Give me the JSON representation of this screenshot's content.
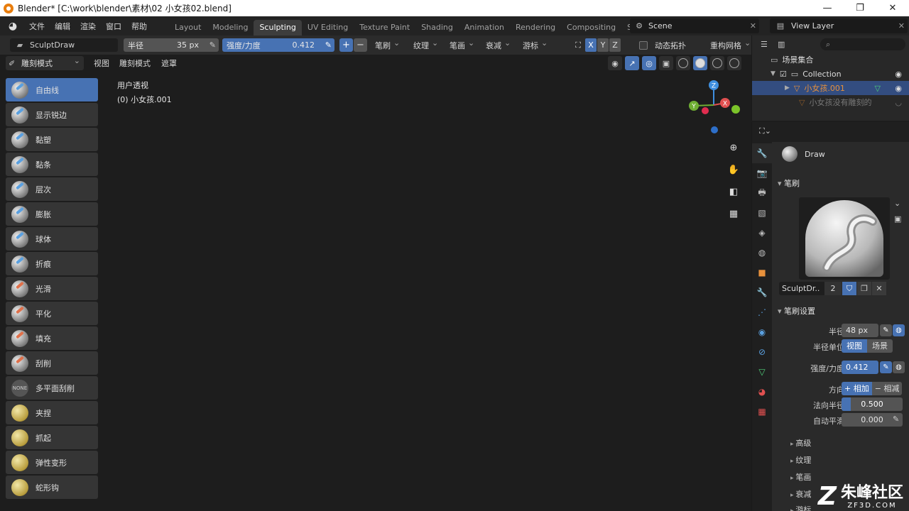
{
  "window": {
    "title": "Blender* [C:\\work\\blender\\素材\\02 小女孩02.blend]",
    "controls": [
      "—",
      "❐",
      "✕"
    ]
  },
  "menubar": {
    "items": [
      "文件",
      "编辑",
      "渲染",
      "窗口",
      "帮助"
    ],
    "workspaces": [
      "Layout",
      "Modeling",
      "Sculpting",
      "UV Editing",
      "Texture Paint",
      "Shading",
      "Animation",
      "Rendering",
      "Compositing",
      "Sc"
    ],
    "active_workspace": "Sculpting",
    "scene": "Scene",
    "view_layer": "View Layer"
  },
  "tool_header": {
    "brush_name": "SculptDraw",
    "radius_label": "半径",
    "radius_value": "35 px",
    "strength_label": "强度/力度",
    "strength_value": "0.412",
    "plus": "+",
    "minus": "−",
    "dropdowns": [
      "笔刷",
      "纹理",
      "笔画",
      "衰减",
      "游标"
    ],
    "axes": [
      "X",
      "Y",
      "Z"
    ],
    "dyntopo": "动态拓扑",
    "remesh": "重构网格"
  },
  "viewport_header": {
    "mode": "雕刻模式",
    "menus": [
      "视图",
      "雕刻模式",
      "遮罩"
    ]
  },
  "viewport": {
    "view_name": "用户透视",
    "object_label": "(0) 小女孩.001",
    "gizmo": {
      "x": "X",
      "y": "Y",
      "z": "Z"
    }
  },
  "tools": [
    {
      "label": "自由线",
      "active": true
    },
    {
      "label": "显示锐边"
    },
    {
      "label": "黏塑"
    },
    {
      "label": "黏条"
    },
    {
      "label": "层次"
    },
    {
      "label": "膨胀"
    },
    {
      "label": "球体"
    },
    {
      "label": "折痕"
    },
    {
      "label": "光滑"
    },
    {
      "label": "平化"
    },
    {
      "label": "填充"
    },
    {
      "label": "刮削"
    },
    {
      "label": "多平面刮削"
    },
    {
      "label": "夹捏"
    },
    {
      "label": "抓起"
    },
    {
      "label": "弹性变形"
    },
    {
      "label": "蛇形钩"
    }
  ],
  "outliner": {
    "scene_collection": "场景集合",
    "collection": "Collection",
    "object_selected": "小女孩.001",
    "object_other": "小女孩没有雕刻的"
  },
  "properties": {
    "brush_title": "Draw",
    "panel_brush": "笔刷",
    "brush_slot_name": "SculptDr..",
    "brush_slot_users": "2",
    "panel_brush_settings": "笔刷设置",
    "radius_label": "半径",
    "radius_value": "48 px",
    "radius_unit_label": "半径单位",
    "radius_unit_options": [
      "视图",
      "场景"
    ],
    "strength_label": "强度/力度",
    "strength_value": "0.412",
    "direction_label": "方向",
    "direction_options": [
      "+ 相加",
      "− 相减"
    ],
    "normal_radius_label": "法向半径",
    "normal_radius_value": 0.5,
    "normal_radius_text": "0.500",
    "autosmooth_label": "自动平滑",
    "autosmooth_value": "0.000",
    "subpanels": [
      "高级",
      "纹理",
      "笔画",
      "衰减",
      "游标"
    ]
  },
  "watermark": {
    "name": "朱峰社区",
    "url": "ZF3D.COM"
  },
  "colors": {
    "accent": "#4772b3",
    "bg_dark": "#1d1d1d",
    "viewport": "#414141",
    "mesh": "#b9bcbd",
    "brush_cursor": "#1d3fa8"
  }
}
